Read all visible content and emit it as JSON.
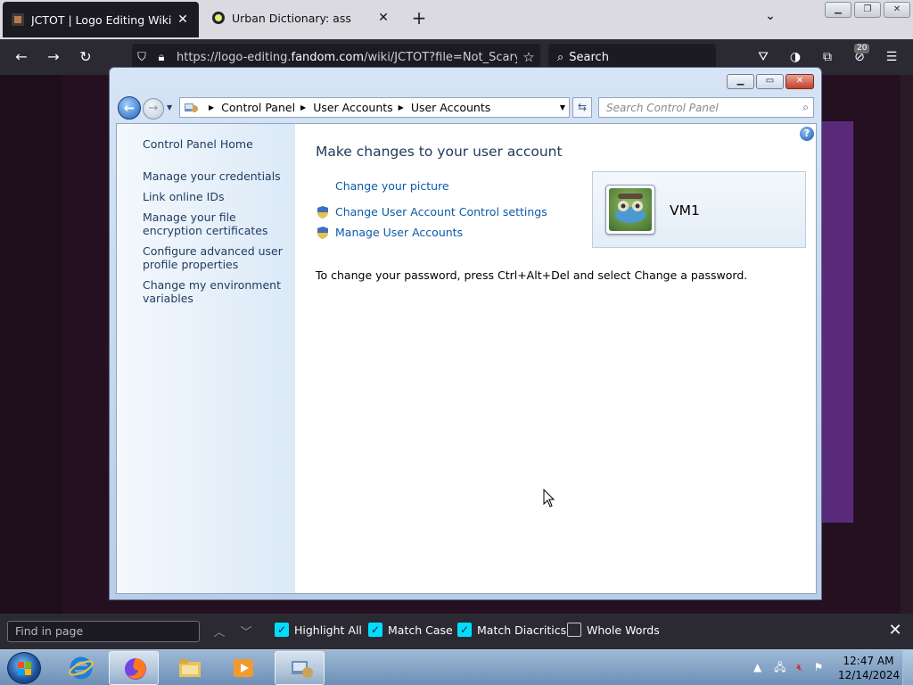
{
  "browser": {
    "tabs": [
      {
        "title": "JCTOT | Logo Editing Wiki | Fan",
        "active": true
      },
      {
        "title": "Urban Dictionary: ass",
        "active": false
      }
    ],
    "url_prefix": "https://logo-editing.",
    "url_domain": "fandom.com",
    "url_suffix": "/wiki/JCTOT?file=Not_Scary",
    "search_placeholder": "Search",
    "extensions_badge": "20"
  },
  "control_panel": {
    "breadcrumb": [
      "Control Panel",
      "User Accounts",
      "User Accounts"
    ],
    "search_placeholder": "Search Control Panel",
    "left_links": [
      "Control Panel Home",
      "Manage your credentials",
      "Link online IDs",
      "Manage your file encryption certificates",
      "Configure advanced user profile properties",
      "Change my environment variables"
    ],
    "heading": "Make changes to your user account",
    "tasks": [
      {
        "label": "Change your picture",
        "shield": false
      },
      {
        "label": "Change User Account Control settings",
        "shield": true
      },
      {
        "label": "Manage User Accounts",
        "shield": true
      }
    ],
    "password_note": "To change your password, press Ctrl+Alt+Del and select Change a password.",
    "user_name": "VM1"
  },
  "findbar": {
    "placeholder": "Find in page",
    "options": [
      {
        "label": "Highlight All",
        "checked": true
      },
      {
        "label": "Match Case",
        "checked": true
      },
      {
        "label": "Match Diacritics",
        "checked": true
      },
      {
        "label": "Whole Words",
        "checked": false
      }
    ]
  },
  "taskbar": {
    "time": "12:47 AM",
    "date": "12/14/2024"
  },
  "colors": {
    "link": "#0b5aa8",
    "heading": "#1e395b",
    "find_check": "#00ddff"
  }
}
